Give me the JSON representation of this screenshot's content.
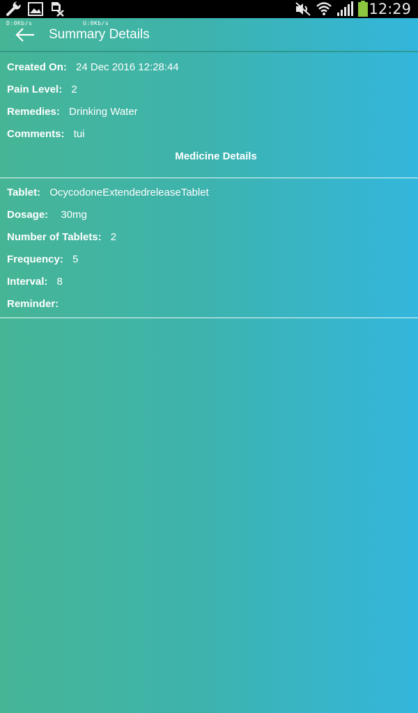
{
  "status_bar": {
    "time": "12:29",
    "icons": [
      "wrench-icon",
      "image-icon",
      "sim-card-icon",
      "mute-icon",
      "wifi-icon",
      "signal-icon",
      "battery-icon"
    ]
  },
  "network_speed": {
    "download": "D:0Kb/s",
    "upload": "U:0Kb/s"
  },
  "toolbar": {
    "title": "Summary Details",
    "back_icon": "arrow-left-icon"
  },
  "summary": {
    "created_on_label": "Created On:",
    "created_on_value": "24 Dec 2016 12:28:44",
    "pain_level_label": "Pain Level:",
    "pain_level_value": "2",
    "remedies_label": "Remedies:",
    "remedies_value": "Drinking Water",
    "comments_label": "Comments:",
    "comments_value": "tui"
  },
  "medicine_section_title": "Medicine Details",
  "medicine": {
    "tablet_label": "Tablet:",
    "tablet_value": "OcycodoneExtendedreleaseTablet",
    "dosage_label": "Dosage:",
    "dosage_value": "30mg",
    "number_label": "Number of Tablets:",
    "number_value": "2",
    "frequency_label": "Frequency:",
    "frequency_value": "5",
    "interval_label": "Interval:",
    "interval_value": "8",
    "reminder_label": "Reminder:",
    "reminder_value": ""
  },
  "colors": {
    "gradient_start": "#46b596",
    "gradient_end": "#33b6dc",
    "battery": "#8dc63f"
  }
}
